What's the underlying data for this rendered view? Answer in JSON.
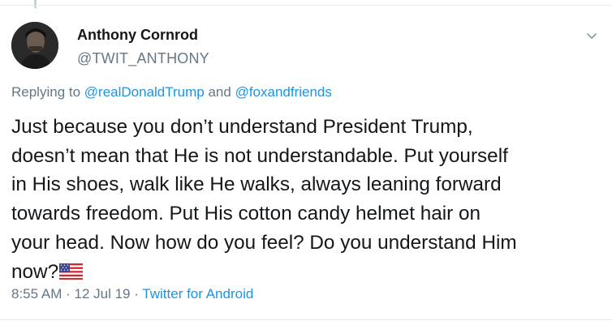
{
  "tweet": {
    "author_name": "Anthony Cornrod",
    "author_handle": "@TWIT_ANTHONY",
    "reply": {
      "prefix": "Replying to ",
      "mention1": "@realDonaldTrump",
      "joiner": " and ",
      "mention2": "@foxandfriends"
    },
    "lines": [
      "Just because you don’t understand President Trump,",
      "doesn’t mean that He is not understandable. Put yourself",
      "in His shoes, walk like He walks, always leaning forward",
      "towards freedom. Put His cotton candy helmet hair on",
      "your head. Now how do you feel? Do you understand Him",
      "now?"
    ],
    "emoji": "us-flag-icon",
    "time": "8:55 AM",
    "separator": " · ",
    "date": "12 Jul 19",
    "source": "Twitter for Android"
  },
  "icons": {
    "menu": "chevron-down-icon",
    "avatar": "avatar"
  },
  "colors": {
    "primary_text": "#14171a",
    "secondary_text": "#657786",
    "link": "#1b95e0",
    "border": "#e6ecf0"
  }
}
